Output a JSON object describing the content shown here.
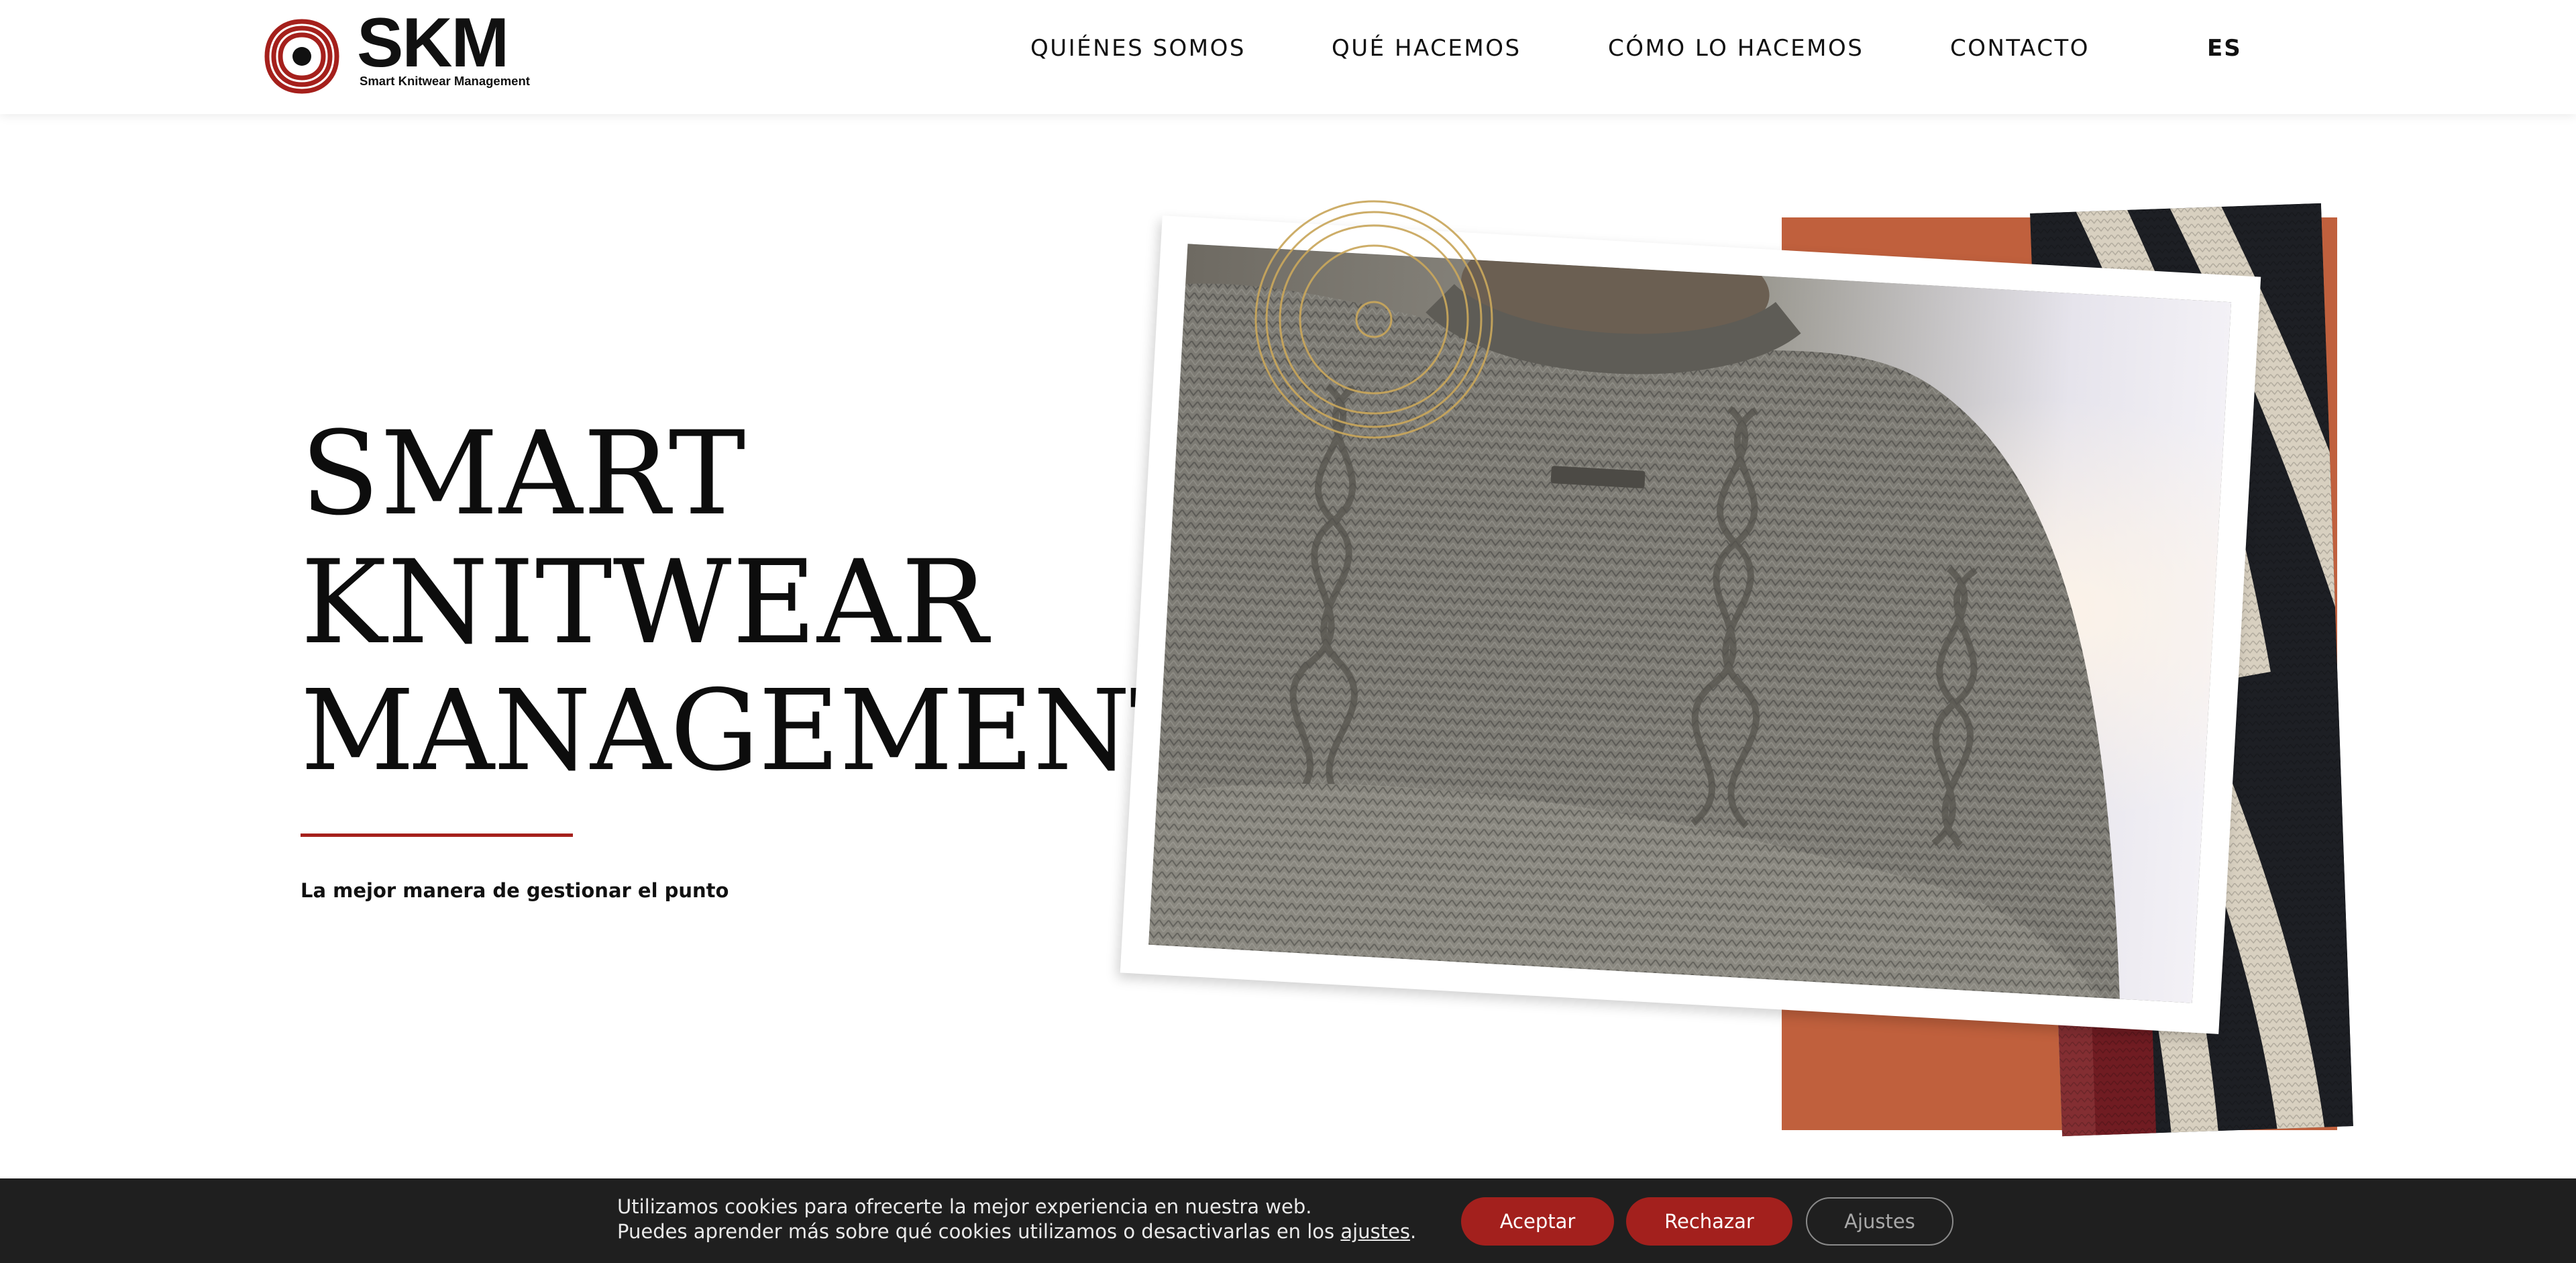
{
  "brand": {
    "name": "SKM",
    "tagline": "Smart Knitwear Management",
    "color_red": "#a5201c",
    "color_dark": "#111111",
    "color_orange": "#c0603d",
    "color_gold": "#c9a75c"
  },
  "nav": {
    "items": [
      {
        "label": "QUIÉNES SOMOS"
      },
      {
        "label": "QUÉ HACEMOS"
      },
      {
        "label": "CÓMO LO HACEMOS"
      },
      {
        "label": "CONTACTO"
      }
    ],
    "language": "ES"
  },
  "hero": {
    "title_lines": [
      "SMART",
      "KNITWEAR",
      "MANAGEMENT"
    ],
    "subtitle": "La mejor manera de gestionar el punto",
    "images": [
      "knitwear-sweater-photo",
      "striped-knit-photo",
      "gold-logo-emblem"
    ]
  },
  "cookie_bar": {
    "line1": "Utilizamos cookies para ofrecerte la mejor experiencia en nuestra web.",
    "line2_prefix": "Puedes aprender más sobre qué cookies utilizamos o desactivarlas en los ",
    "line2_link": "ajustes",
    "line2_suffix": ".",
    "accept_label": "Aceptar",
    "reject_label": "Rechazar",
    "settings_label": "Ajustes",
    "background": "#1f1f1f",
    "button_color": "#a3201d"
  }
}
